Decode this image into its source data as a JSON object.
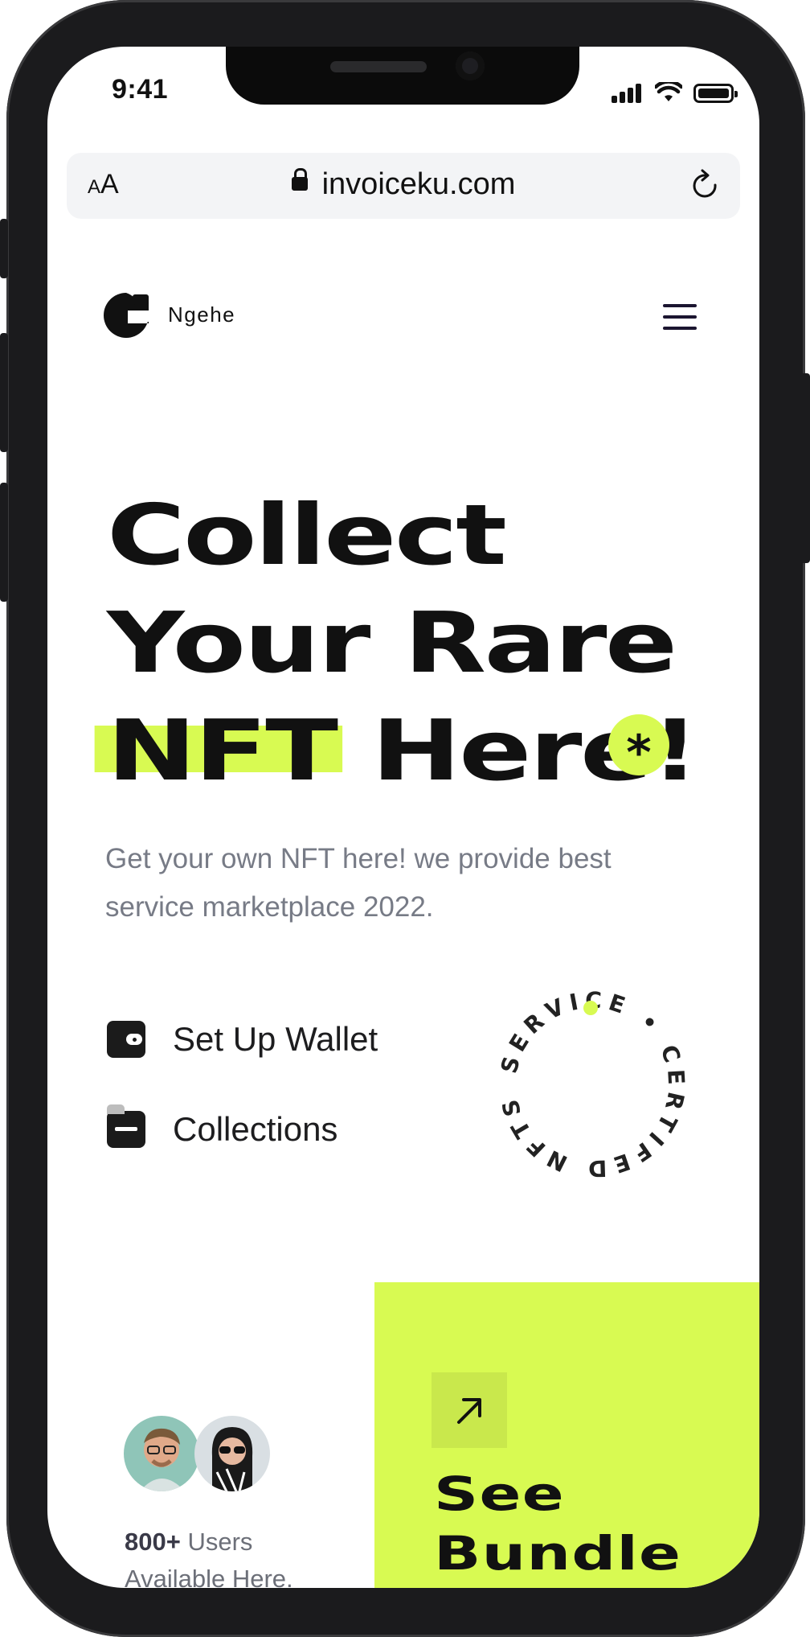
{
  "status_bar": {
    "time": "9:41"
  },
  "browser": {
    "aa_small": "A",
    "aa_large": "A",
    "url": "invoiceku.com"
  },
  "nav": {
    "brand": "Ngehe"
  },
  "hero": {
    "line1": "Collect",
    "line2": "Your Rare",
    "line3_highlight": "NFT",
    "line3_rest": "Here!",
    "star": "*",
    "subtitle": "Get your own NFT here! we provide best service marketplace 2022."
  },
  "features": [
    {
      "label": "Set Up Wallet",
      "icon": "wallet-icon"
    },
    {
      "label": "Collections",
      "icon": "folder-icon"
    }
  ],
  "badge": {
    "text": "SERVICE • CERTIFED NFTSERS"
  },
  "users": {
    "count": "800+",
    "label": "Users",
    "line2": "Available Here."
  },
  "card": {
    "title_line1": "See",
    "title_line2": "Bundle",
    "icon": "arrow-up-right-icon"
  },
  "colors": {
    "accent": "#d8fa52",
    "text": "#111111",
    "muted": "#777b86"
  }
}
